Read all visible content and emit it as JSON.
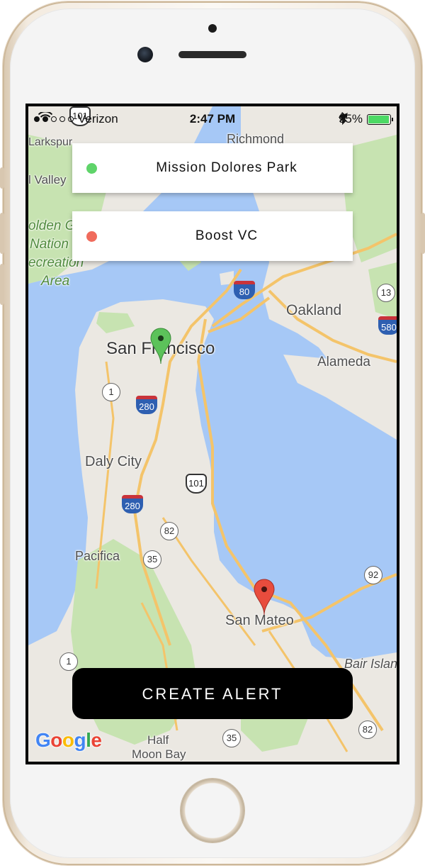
{
  "status_bar": {
    "carrier": "Verizon",
    "time": "2:47 PM",
    "battery_percent": "95%",
    "battery_level": 0.95,
    "signal_bars_filled": 2,
    "signal_bars_total": 5,
    "icons": [
      "wifi-icon",
      "location-arrow-icon",
      "bluetooth-icon",
      "battery-icon",
      "charging-icon"
    ]
  },
  "locations": [
    {
      "name": "Mission Dolores Park",
      "color": "#5fd46a"
    },
    {
      "name": "Boost VC",
      "color": "#f06b5c"
    }
  ],
  "map": {
    "attribution": "Google",
    "place_labels": {
      "richmond": "Richmond",
      "larkspur": "Larkspur",
      "mill_valley": "l Valley",
      "oakland": "Oakland",
      "alameda": "Alameda",
      "san_francisco": "San Francisco",
      "daly_city": "Daly City",
      "pacifica": "Pacifica",
      "san_mateo": "San Mateo",
      "bair_island": "Bair Islan",
      "half_moon_bay_1": "Half",
      "half_moon_bay_2": "Moon Bay"
    },
    "park_label_lines": [
      "olden G",
      "Nation",
      "ecreation",
      "Area"
    ],
    "highway_shields": {
      "i80": "80",
      "i280_a": "280",
      "i280_b": "280",
      "i580": "580",
      "us101_a": "101",
      "us101_b": "101",
      "sr1_a": "1",
      "sr1_b": "1",
      "sr13": "13",
      "sr82_a": "82",
      "sr82_b": "82",
      "sr35_a": "35",
      "sr35_b": "35",
      "sr92": "92"
    },
    "colors": {
      "water": "#a6c8f6",
      "land": "#ebe8e2",
      "park": "#c7e3b1",
      "highway": "#f4c46a"
    }
  },
  "create_alert": {
    "label": "CREATE ALERT"
  }
}
